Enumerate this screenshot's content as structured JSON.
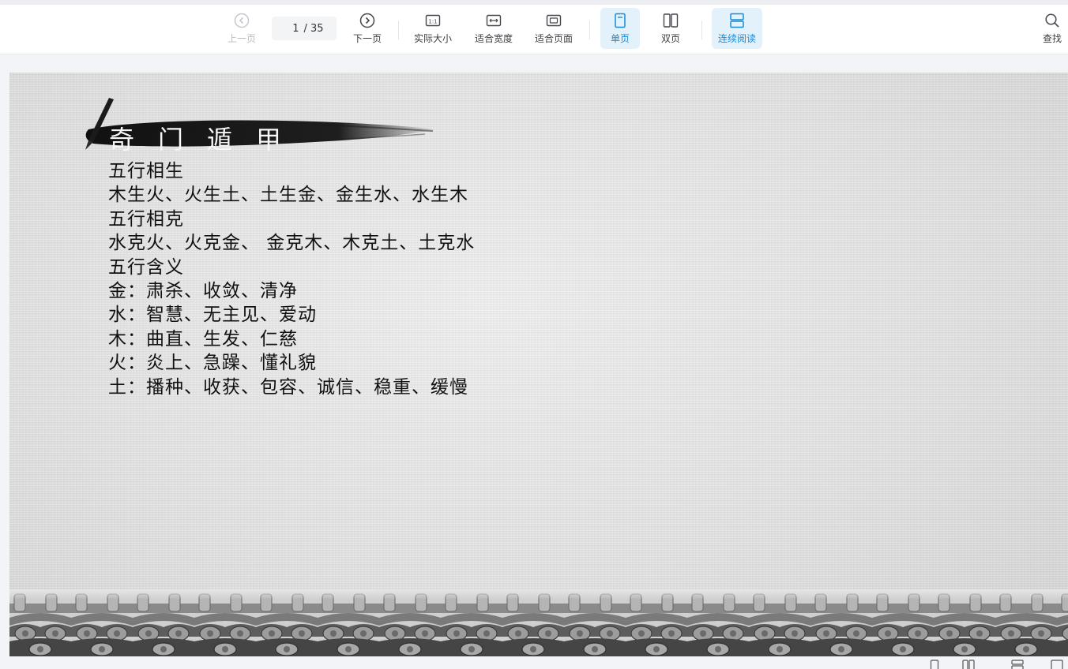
{
  "toolbar": {
    "prev_label": "上一页",
    "next_label": "下一页",
    "current_page": "1",
    "page_total": "/ 35",
    "actual_size_label": "实际大小",
    "fit_width_label": "适合宽度",
    "fit_page_label": "适合页面",
    "single_page_label": "单页",
    "double_page_label": "双页",
    "continuous_label": "连续阅读",
    "search_label": "查找",
    "icons": [
      "chevron-left-circle-icon",
      "chevron-right-circle-icon",
      "actual-size-icon",
      "fit-width-icon",
      "fit-page-icon",
      "single-page-icon",
      "double-page-icon",
      "continuous-icon",
      "search-icon"
    ],
    "active": [
      "single-page",
      "continuous"
    ],
    "accent_color": "#1a8bd6",
    "active_bg": "#e3f1fb"
  },
  "document": {
    "title": "奇门遁甲",
    "lines": [
      "五行相生",
      "木生火、火生土、土生金、金生水、水生木",
      "五行相克",
      "水克火、火克金、 金克木、木克土、土克水",
      "五行含义",
      "金：肃杀、收敛、清净",
      "水：智慧、无主见、爱动",
      "木：曲直、生发、仁慈",
      "火：炎上、急躁、懂礼貌",
      "土：播种、收获、包容、诚信、稳重、缓慢"
    ]
  }
}
